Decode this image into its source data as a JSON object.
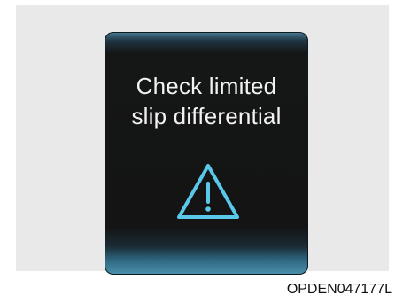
{
  "display": {
    "message_line_1": "Check limited",
    "message_line_2": "slip differential",
    "icon": "warning-triangle-icon",
    "icon_color": "#5ac8e8",
    "text_color": "#f2f2f2"
  },
  "figure": {
    "code": "OPDEN047177L"
  }
}
